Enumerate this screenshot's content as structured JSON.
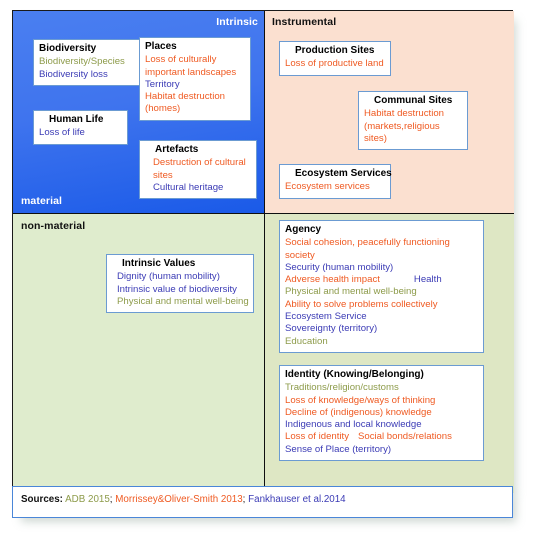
{
  "figure": {
    "axes": {
      "intrinsic_label": "Intrinsic",
      "instrumental_label": "Instrumental",
      "material_label": "material",
      "non_material_label": "non-material"
    },
    "colors": {
      "intrinsic_material_bg": "#3f74ee",
      "instrumental_material_bg": "#fbe0d0",
      "intrinsic_nonmaterial_bg": "#dfeccd",
      "instrumental_nonmaterial_bg": "#dee7c4",
      "card_border": "#6b9bd2",
      "orange_text": "#ef5a22",
      "blue_text": "#3b3bb5",
      "olive_text": "#8d9b4a"
    }
  },
  "quadrants": {
    "intrinsic_material": {
      "cards": [
        {
          "title": "Biodiversity",
          "lines": [
            {
              "text": "Biodiversity/Species",
              "color": "olive"
            },
            {
              "text": "Biodiversity loss",
              "color": "blue"
            }
          ]
        },
        {
          "title": "Human Life",
          "lines": [
            {
              "text": "Loss of life",
              "color": "blue"
            }
          ]
        },
        {
          "title": "Places",
          "lines": [
            {
              "text": "Loss of culturally important landscapes",
              "color": "orange"
            },
            {
              "text": "Territory",
              "color": "blue"
            },
            {
              "text": "Habitat destruction (homes)",
              "color": "orange"
            }
          ]
        },
        {
          "title": "Artefacts",
          "lines": [
            {
              "text": "Destruction of cultural sites",
              "color": "orange"
            },
            {
              "text": "Cultural heritage",
              "color": "blue"
            }
          ]
        }
      ]
    },
    "instrumental_material": {
      "cards": [
        {
          "title": "Production Sites",
          "lines": [
            {
              "text": "Loss of productive land",
              "color": "orange"
            }
          ]
        },
        {
          "title": "Communal Sites",
          "lines": [
            {
              "text": "Habitat destruction (markets,religious sites)",
              "color": "orange"
            }
          ]
        },
        {
          "title": "Ecosystem Services",
          "lines": [
            {
              "text": "Ecosystem services",
              "color": "orange"
            }
          ]
        }
      ]
    },
    "intrinsic_nonmaterial": {
      "cards": [
        {
          "title": "Intrinsic Values",
          "lines": [
            {
              "text": "Dignity (human mobility)",
              "color": "blue"
            },
            {
              "text": "Intrinsic value of biodiversity",
              "color": "blue"
            },
            {
              "text": "Physical and mental well-being",
              "color": "olive"
            }
          ]
        }
      ]
    },
    "instrumental_nonmaterial": {
      "cards": [
        {
          "title": "Agency",
          "lines": [
            {
              "text": "Social cohesion, peacefully functioning society",
              "color": "orange"
            },
            {
              "text": "Security (human mobility)",
              "color": "blue"
            },
            {
              "text": "Adverse health impact",
              "color": "orange"
            },
            {
              "text": "Health",
              "color": "blue"
            },
            {
              "text": "Physical and mental well-being",
              "color": "olive"
            },
            {
              "text": "Ability to solve problems collectively",
              "color": "orange"
            },
            {
              "text": "Ecosystem Service",
              "color": "blue"
            },
            {
              "text": "Sovereignty (territory)",
              "color": "blue"
            },
            {
              "text": "Education",
              "color": "olive"
            }
          ]
        },
        {
          "title": "Identity (Knowing/Belonging)",
          "lines": [
            {
              "text": "Traditions/religion/customs",
              "color": "olive"
            },
            {
              "text": "Loss of knowledge/ways of thinking",
              "color": "orange"
            },
            {
              "text": "Decline of (indigenous) knowledge",
              "color": "orange"
            },
            {
              "text": "Indigenous and local knowledge",
              "color": "blue"
            },
            {
              "text": "Loss of identity",
              "color": "orange"
            },
            {
              "text": "Social bonds/relations",
              "color": "orange"
            },
            {
              "text": "Sense of Place (territory)",
              "color": "blue"
            }
          ]
        }
      ]
    }
  },
  "sources": {
    "label": "Sources:",
    "items": [
      {
        "text": "ADB 2015",
        "color": "olive"
      },
      {
        "text": "Morrissey&Oliver-Smith 2013",
        "color": "orange"
      },
      {
        "text": "Fankhauser et al.2014",
        "color": "blue"
      }
    ],
    "separator": ";"
  }
}
